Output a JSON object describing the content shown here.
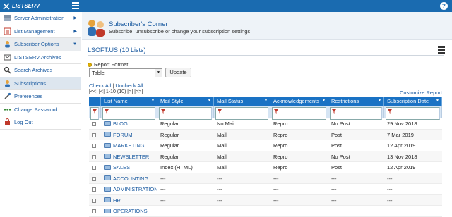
{
  "app": {
    "name": "LISTSERV",
    "help_label": "?"
  },
  "sidebar": {
    "items": [
      {
        "label": "Server Administration",
        "icon": "server-icon",
        "arrow": "▶"
      },
      {
        "label": "List Management",
        "icon": "list-icon",
        "arrow": "▶"
      },
      {
        "label": "Subscriber Options",
        "icon": "subscriber-icon",
        "arrow": "▼"
      },
      {
        "label": "LISTSERV Archives",
        "icon": "archive-icon"
      },
      {
        "label": "Search Archives",
        "icon": "search-icon"
      },
      {
        "label": "Subscriptions",
        "icon": "subscriptions-icon"
      },
      {
        "label": "Preferences",
        "icon": "preferences-icon"
      },
      {
        "label": "Change Password",
        "icon": "password-icon"
      },
      {
        "label": "Log Out",
        "icon": "logout-icon"
      }
    ]
  },
  "banner": {
    "title": "Subscriber's Corner",
    "subtitle": "Subscribe, unsubscribe or change your subscription settings"
  },
  "lists": {
    "title": "LSOFT.US (10 Lists)",
    "report_format_label": "Report Format:",
    "report_format_value": "Table",
    "update_label": "Update",
    "check_all": "Check All",
    "separator": "|",
    "uncheck_all": "Uncheck All",
    "pager": "[<<] [<] 1-10 (10) [>] [>>]",
    "customize": "Customize Report"
  },
  "table": {
    "columns": [
      "List Name",
      "Mail Style",
      "Mail Status",
      "Acknowledgements",
      "Restrictions",
      "Subscription Date"
    ],
    "rows": [
      [
        "BLOG",
        "Regular",
        "No Mail",
        "Repro",
        "No Post",
        "29 Nov 2018"
      ],
      [
        "FORUM",
        "Regular",
        "Mail",
        "Repro",
        "Post",
        "7 Mar 2019"
      ],
      [
        "MARKETING",
        "Regular",
        "Mail",
        "Repro",
        "Post",
        "12 Apr 2019"
      ],
      [
        "NEWSLETTER",
        "Regular",
        "Mail",
        "Repro",
        "No Post",
        "13 Nov 2018"
      ],
      [
        "SALES",
        "Index (HTML)",
        "Mail",
        "Repro",
        "Post",
        "12 Apr 2019"
      ],
      [
        "ACCOUNTING",
        "---",
        "---",
        "---",
        "---",
        "---"
      ],
      [
        "ADMINISTRATION",
        "---",
        "---",
        "---",
        "---",
        "---"
      ],
      [
        "HR",
        "---",
        "---",
        "---",
        "---",
        "---"
      ],
      [
        "OPERATIONS",
        "",
        "",
        "",
        "",
        ""
      ]
    ]
  },
  "colors": {
    "brand": "#1a6bb0",
    "header": "#1a72c4",
    "link": "#1a5aa0"
  }
}
